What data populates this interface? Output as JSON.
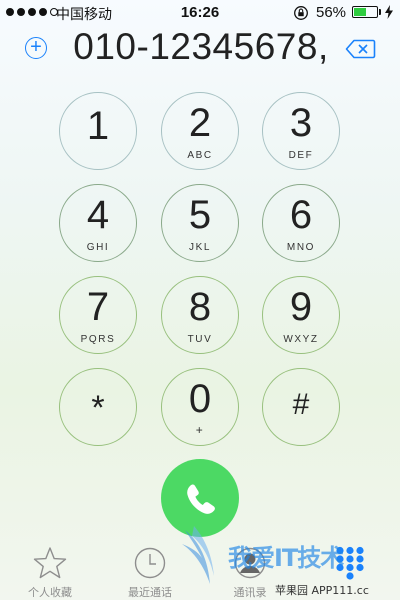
{
  "status_bar": {
    "carrier": "中国移动",
    "time": "16:26",
    "battery_percent": "56%",
    "battery_level": 0.56,
    "signal_bars_filled": 4,
    "signal_bars_total": 5
  },
  "dialer": {
    "number": "010-12345678,"
  },
  "keypad": [
    {
      "digit": "1",
      "letters": ""
    },
    {
      "digit": "2",
      "letters": "ABC"
    },
    {
      "digit": "3",
      "letters": "DEF"
    },
    {
      "digit": "4",
      "letters": "GHI"
    },
    {
      "digit": "5",
      "letters": "JKL"
    },
    {
      "digit": "6",
      "letters": "MNO"
    },
    {
      "digit": "7",
      "letters": "PQRS"
    },
    {
      "digit": "8",
      "letters": "TUV"
    },
    {
      "digit": "9",
      "letters": "WXYZ"
    },
    {
      "digit": "*",
      "letters": ""
    },
    {
      "digit": "0",
      "letters": "+"
    },
    {
      "digit": "#",
      "letters": ""
    }
  ],
  "tabs": [
    {
      "label": "个人收藏",
      "icon": "star-icon"
    },
    {
      "label": "最近通话",
      "icon": "clock-icon"
    },
    {
      "label": "通讯录",
      "icon": "contacts-icon"
    },
    {
      "label": "",
      "icon": "keypad-icon"
    }
  ],
  "watermark": {
    "title": "我爱IT技术",
    "subtitle": "苹果园  APP111.cc"
  },
  "colors": {
    "accent": "#1a82fb",
    "call": "#4cd964",
    "battery": "#2ecc40"
  }
}
